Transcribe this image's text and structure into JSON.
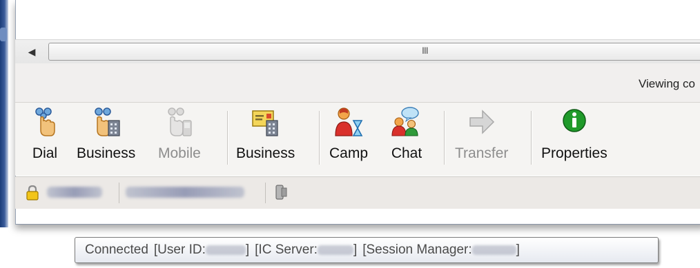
{
  "scrollbar": {
    "left_arrow": "◀",
    "grip": "III"
  },
  "status_strip": {
    "viewing_text": "Viewing co"
  },
  "toolbar": {
    "buttons": [
      {
        "label": "Dial",
        "icon": "dial-hand-icon",
        "enabled": true
      },
      {
        "label": "Business",
        "icon": "dial-business-icon",
        "enabled": true
      },
      {
        "label": "Mobile",
        "icon": "dial-mobile-icon",
        "enabled": false
      },
      {
        "label": "Business",
        "icon": "business-card-icon",
        "enabled": true
      },
      {
        "label": "Camp",
        "icon": "camp-user-hourglass-icon",
        "enabled": true
      },
      {
        "label": "Chat",
        "icon": "chat-users-icon",
        "enabled": true
      },
      {
        "label": "Transfer",
        "icon": "transfer-arrow-icon",
        "enabled": false
      },
      {
        "label": "Properties",
        "icon": "info-properties-icon",
        "enabled": true
      }
    ]
  },
  "bottom_bar": {
    "lock_icon": "lock-icon",
    "phone_icon": "phone-icon"
  },
  "tooltip": {
    "connected": "Connected",
    "user_id_label": "[User ID:",
    "user_id_close": "]",
    "ic_server_label": "[IC Server:",
    "ic_server_close": "]",
    "session_manager_label": "[Session Manager:",
    "session_manager_close": "]"
  },
  "colors": {
    "toolbar_bg": "#f5f4f2",
    "status_bg": "#f1efee",
    "disabled_text": "#8d8d8d",
    "properties_green": "#1f9a2a",
    "lock_gold": "#e6b400"
  }
}
